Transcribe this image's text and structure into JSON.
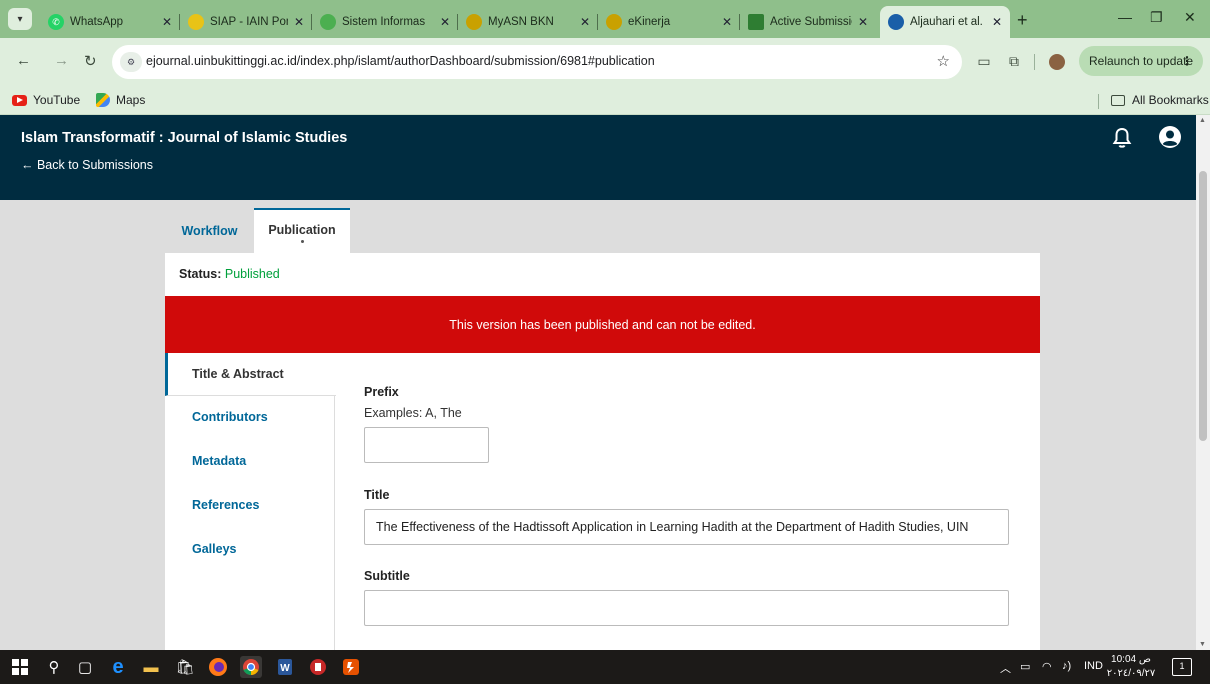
{
  "browser": {
    "tabs": [
      {
        "title": "WhatsApp",
        "icon": "whatsapp-icon",
        "color": "#25d366"
      },
      {
        "title": "SIAP - IAIN Ponc",
        "icon": "siap-icon",
        "color": "#e8c317"
      },
      {
        "title": "Sistem Informas",
        "icon": "sistem-informasi-icon",
        "color": "#4caf50"
      },
      {
        "title": "MyASN BKN",
        "icon": "myasn-icon",
        "color": "#c9a100"
      },
      {
        "title": "eKinerja",
        "icon": "ekinerja-icon",
        "color": "#c9a100"
      },
      {
        "title": "Active Submissio",
        "icon": "ojs-icon",
        "color": "#2e7d32"
      },
      {
        "title": "Aljauhari et al. |",
        "icon": "ojs-journal-icon",
        "color": "#1a5fa8"
      }
    ],
    "url": "ejournal.uinbukittinggi.ac.id/index.php/islamt/authorDashboard/submission/6981#publication",
    "relaunch_label": "Relaunch to update",
    "bookmarks": [
      {
        "label": "YouTube",
        "icon": "youtube-icon"
      },
      {
        "label": "Maps",
        "icon": "maps-icon"
      }
    ],
    "all_bookmarks": "All Bookmarks"
  },
  "header": {
    "journal_title": "Islam Transformatif : Journal of Islamic Studies",
    "back_link": "← Back to Submissions"
  },
  "page_tabs": {
    "workflow": "Workflow",
    "publication": "Publication"
  },
  "publication": {
    "status_label": "Status:",
    "status_value": "Published",
    "notice": "This version has been published and can not be edited.",
    "menu": [
      {
        "label": "Title & Abstract",
        "active": true
      },
      {
        "label": "Contributors",
        "active": false
      },
      {
        "label": "Metadata",
        "active": false
      },
      {
        "label": "References",
        "active": false
      },
      {
        "label": "Galleys",
        "active": false
      }
    ],
    "form": {
      "prefix_label": "Prefix",
      "prefix_hint": "Examples: A, The",
      "prefix_value": "",
      "title_label": "Title",
      "title_value": "The Effectiveness of the Hadtissoft Application in Learning Hadith at the Department of Hadith Studies, UIN",
      "subtitle_label": "Subtitle",
      "subtitle_value": ""
    }
  },
  "taskbar": {
    "language": "IND",
    "time": "10:04 ص",
    "date": "٢٠٢٤/٠٩/٢٧",
    "notification_count": "1"
  },
  "colors": {
    "header_bg": "#002c40",
    "link": "#006798",
    "published": "#00a03b",
    "notice_bg": "#d00a0a"
  }
}
